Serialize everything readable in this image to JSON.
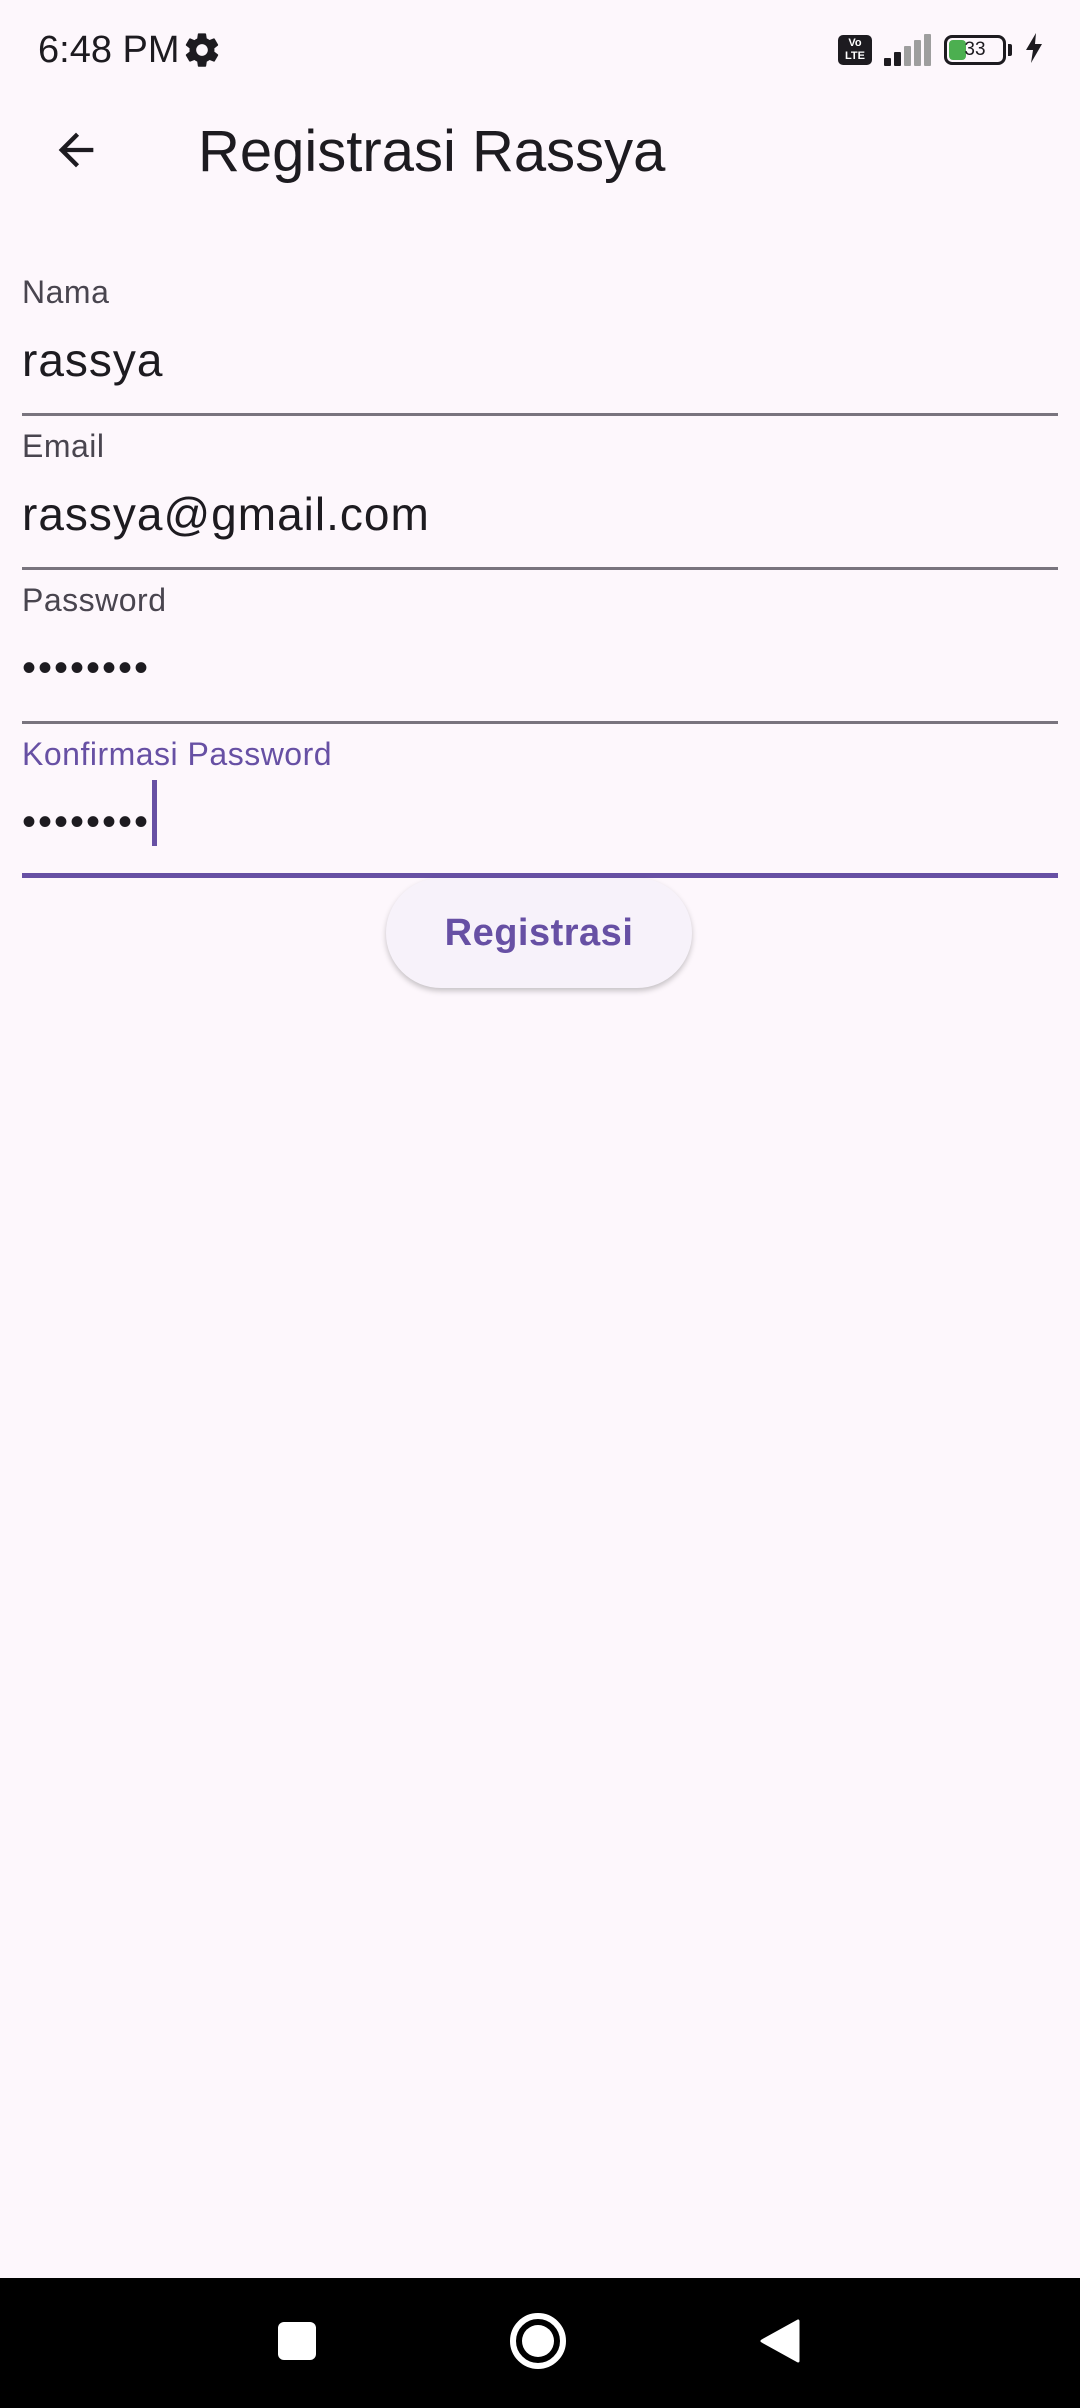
{
  "status_bar": {
    "time": "6:48 PM",
    "volte": "Vo LTE",
    "battery_level": 33,
    "battery_text": "33",
    "icons": [
      "gear-icon",
      "volte-icon",
      "signal-icon",
      "battery-icon",
      "charging-icon"
    ]
  },
  "app_bar": {
    "title": "Registrasi Rassya",
    "back_icon": "arrow-left-icon"
  },
  "form": {
    "nama": {
      "label": "Nama",
      "value": "rassya"
    },
    "email": {
      "label": "Email",
      "value": "rassya@gmail.com"
    },
    "password": {
      "label": "Password",
      "value": "••••••••"
    },
    "konfirmasi": {
      "label": "Konfirmasi Password",
      "value": "••••••••"
    }
  },
  "register_button": {
    "label": "Registrasi"
  },
  "nav_bar": {
    "icons": [
      "recents-square-icon",
      "home-circle-icon",
      "back-triangle-icon"
    ]
  },
  "colors": {
    "background": "#fdf7fc",
    "accent": "#6750a4",
    "text": "#1d1b20",
    "label": "#49454f",
    "underline": "#79747e",
    "battery_fill": "#4caf50"
  }
}
